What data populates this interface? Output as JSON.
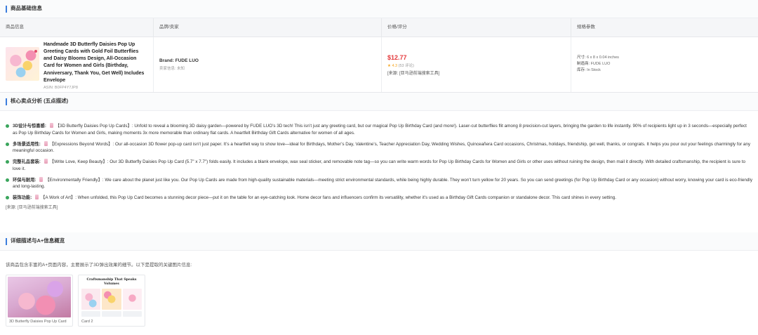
{
  "basic_info": {
    "section_title": "商品基础信息",
    "columns": [
      "商品信息",
      "品牌/卖家",
      "价格/评分",
      "规格参数"
    ],
    "product": {
      "title": "Handmade 3D Butterfly Daisies Pop Up Greeting Cards with Gold Foil Butterflies and Daisy Blooms Design, All-Occasion Card for Women and Girls (Birthday, Anniversary, Thank You, Get Well) Includes Envelope",
      "asin": "ASIN: B0FP4Y7JP8"
    },
    "brand": {
      "brand_text": "Brand: FUDE LUO",
      "seller_text": "卖家信息: 未知"
    },
    "price": {
      "price_text": "$12.77",
      "rating_star": "★",
      "rating_value": "4.3",
      "rating_count": "(53 评论)",
      "source_text": "[来源: [亚马逊前端搜索工具]"
    },
    "specs": {
      "size_label": "尺寸:",
      "size_value": "6 x 8 x 0.04 inches",
      "maker_label": "制造商:",
      "maker_value": "FUDE LUO",
      "stock_label": "库存:",
      "stock_value": "In Stock"
    }
  },
  "selling_points": {
    "section_title": "核心卖点分析 (五点描述)",
    "items": [
      {
        "head": "3D设计与惊喜感:",
        "body": "【3D Butterfly Daisies Pop Up Cards】: Unfold to reveal a blooming 3D daisy garden—powered by FUDE LUO’s 3D tech! This isn’t just any greeting card, but our magical Pop Up Birthday Card (and more!). Laser-cut butterflies flit among 8 precision-cut layers, bringing the garden to life instantly. 90% of recipients light up in 3 seconds—especially perfect as Pop Up Birthday Cards for Women and Girls, making moments 3x more memorable than ordinary flat cards. A heartfelt Birthday Gift Cards alternative for women of all ages."
      },
      {
        "head": "多场景适用性:",
        "body": "【Expressions Beyond Words】: Our all-occasion 3D flower pop-up card isn’t just paper. It’s a heartfelt way to show love—ideal for Birthdays, Mother’s Day, Valentine’s, Teacher Appreciation Day, Wedding Wishes, Quinceañera Card occasions, Christmas, holidays, friendship, get well, thanks, or congrats. It helps you pour out your feelings charmingly for any meaningful occasion."
      },
      {
        "head": "完整礼品套装:",
        "body": "【Write Love, Keep Beauty】: Our 3D Butterfly Daisies Pop Up Card (5.7” x 7.7”) folds easily. It includes a blank envelope, wax seal sticker, and removable note tag—so you can write warm words for Pop Up Birthday Cards for Women and Girls or other uses without ruining the design, then mail it directly. With detailed craftsmanship, the recipient is sure to love it."
      },
      {
        "head": "环保与耐用:",
        "body": "【Environmentally Friendly】: We care about the planet just like you. Our Pop Up Cards are made from high-quality sustainable materials—meeting strict environmental standards, while being highly durable. They won’t turn yellow for 20 years. So you can send greetings (for Pop Up Birthday Card or any occasion) without worry, knowing your card is eco-friendly and long-lasting."
      },
      {
        "head": "装饰功能:",
        "body": "【A Work of Art】: When unfolded, this Pop Up Card becomes a stunning decor piece—put it on the table for an eye-catching look. Home decor fans and influencers confirm its versatility, whether it’s used as a Birthday Gift Cards companion or standalone decor. This card shines in every setting."
      }
    ],
    "source_text": "[来源: [亚马逊前端搜索工具]"
  },
  "aplus": {
    "section_title": "详细描述与A+信息概览",
    "description": "该商品包含丰富的A+页面内容，主要展示了3D弹出效果的细节。以下是提取的关键图片信息:",
    "cards": [
      {
        "label": "3D Butterfly Daisies Pop Up Card"
      },
      {
        "label": "Card 2",
        "image_title": "Craftsmanship That Speaks Volumes"
      }
    ]
  },
  "colors": {
    "accent": "#3b7ddd",
    "price": "#e4393c",
    "star": "#f5a623",
    "bullet": "#3aa55c"
  }
}
